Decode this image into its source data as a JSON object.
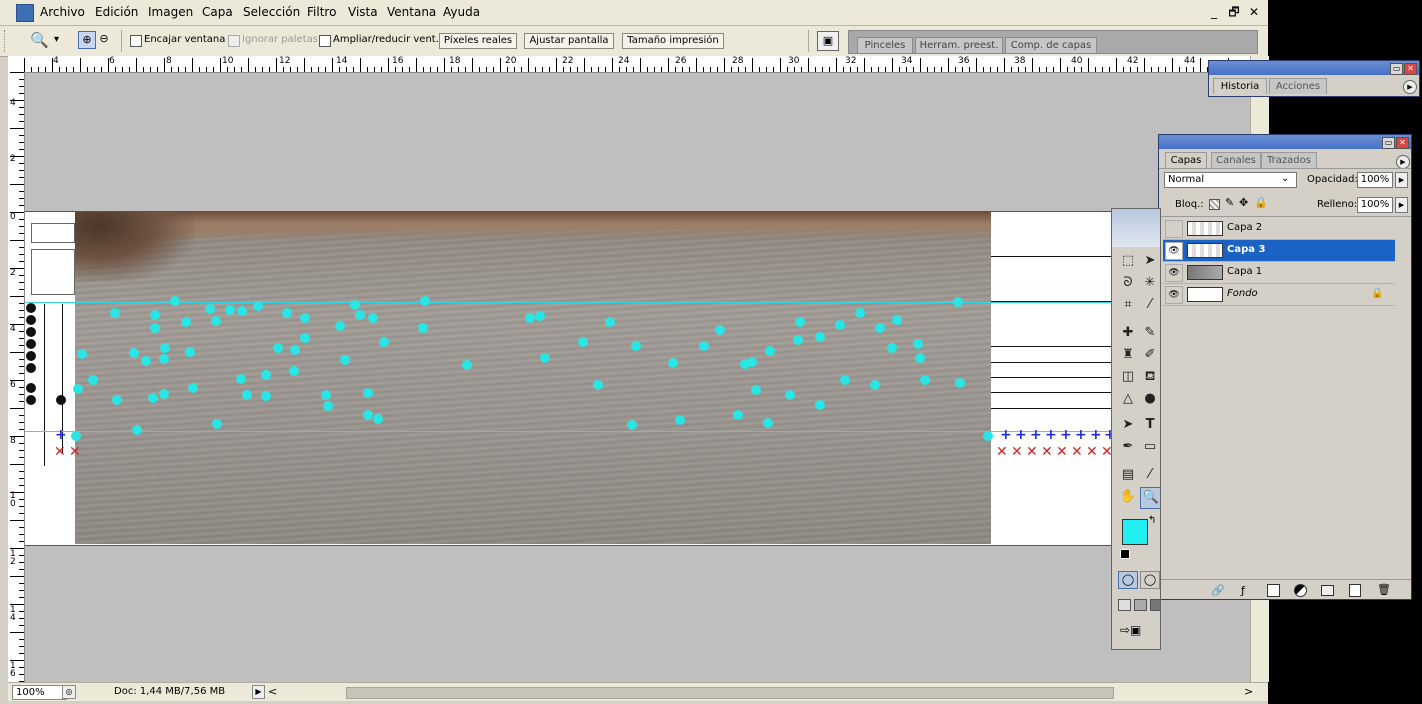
{
  "menubar": {
    "items": [
      "Archivo",
      "Edición",
      "Imagen",
      "Capa",
      "Selección",
      "Filtro",
      "Vista",
      "Ventana",
      "Ayuda"
    ],
    "minimize": "_",
    "restore": "🗗",
    "close": "✕"
  },
  "options": {
    "zoom_dropdown": "▾",
    "encajar_ventana": "Encajar ventana",
    "ignorar_paletas": "Ignorar paletas",
    "ampliar_reducir": "Ampliar/reducir vent.",
    "pixeles_reales": "Píxeles reales",
    "ajustar_pantalla": "Ajustar pantalla",
    "tamano_impresion": "Tamaño impresión"
  },
  "palette_well": {
    "tabs": [
      "Pinceles",
      "Herram. preest.",
      "Comp. de capas"
    ]
  },
  "ruler_top": [
    "4",
    "6",
    "8",
    "10",
    "12",
    "14",
    "16",
    "18",
    "20",
    "22",
    "24",
    "26",
    "28",
    "30",
    "32",
    "34",
    "36",
    "38",
    "40",
    "42",
    "44"
  ],
  "ruler_left": [
    "4",
    "2",
    "0",
    "2",
    "4",
    "6",
    "8",
    "1 0",
    "1 2",
    "1 4",
    "1 6"
  ],
  "historia_panel": {
    "tabs": [
      "Historia",
      "Acciones"
    ]
  },
  "capas_panel": {
    "tabs": [
      "Capas",
      "Canales",
      "Trazados"
    ],
    "blend_mode": "Normal",
    "opacity_label": "Opacidad:",
    "opacity_value": "100%",
    "lock_label": "Bloq.:",
    "fill_label": "Relleno:",
    "fill_value": "100%",
    "layers": [
      {
        "name": "Capa 2",
        "visible": false,
        "selected": false
      },
      {
        "name": "Capa 3",
        "visible": true,
        "selected": true
      },
      {
        "name": "Capa 1",
        "visible": true,
        "selected": false
      },
      {
        "name": "Fondo",
        "visible": true,
        "selected": false
      }
    ]
  },
  "status": {
    "zoom": "100%",
    "doc_info": "Doc: 1,44 MB/7,56 MB",
    "scroll_left": "<",
    "scroll_right": ">"
  },
  "colors": {
    "foreground": "#22f0f0",
    "background": "#ffffff",
    "accent_selected": "#1a62c4",
    "guide": "#36d6e6"
  }
}
